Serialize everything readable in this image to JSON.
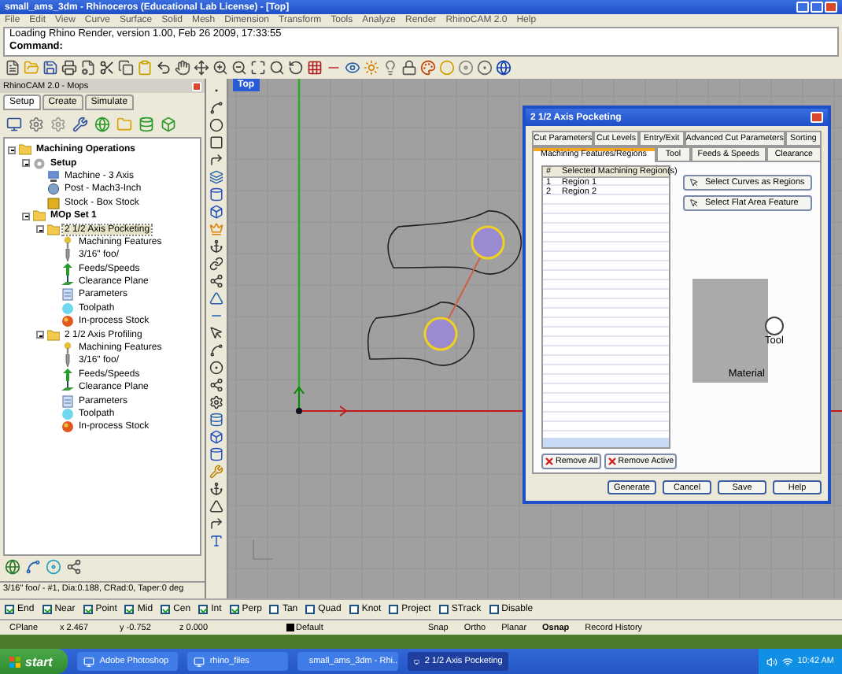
{
  "window": {
    "title": "small_ams_3dm - Rhinoceros (Educational Lab License) - [Top]"
  },
  "menu": [
    "File",
    "Edit",
    "View",
    "Curve",
    "Surface",
    "Solid",
    "Mesh",
    "Dimension",
    "Transform",
    "Tools",
    "Analyze",
    "Render",
    "RhinoCAM 2.0",
    "Help"
  ],
  "command_history": [
    "Loading Rhino Render, version 1.00, Feb 26 2009, 17:33:55"
  ],
  "command_prompt": "Command:",
  "mops_panel": {
    "title": "RhinoCAM 2.0 - Mops",
    "tabs": [
      {
        "label": "Setup",
        "selected": true
      },
      {
        "label": "Create",
        "selected": false
      },
      {
        "label": "Simulate",
        "selected": false
      }
    ],
    "tree": [
      {
        "label": "Machining Operations",
        "kind": "folder",
        "expanded": true,
        "selected": false,
        "children": [
          {
            "label": "Setup",
            "kind": "gear",
            "expanded": true,
            "selected": false,
            "children": [
              {
                "label": "Machine - 3 Axis",
                "kind": "machine",
                "selected": false
              },
              {
                "label": "Post - Mach3-Inch",
                "kind": "post",
                "selected": false
              },
              {
                "label": "Stock - Box Stock",
                "kind": "stock",
                "selected": false
              }
            ]
          },
          {
            "label": "MOp Set 1",
            "kind": "folder",
            "expanded": true,
            "selected": false,
            "children": [
              {
                "label": "2 1/2 Axis Pocketing",
                "kind": "folder",
                "expanded": true,
                "selected": true,
                "children": [
                  {
                    "label": "Machining Features",
                    "kind": "feature",
                    "selected": false
                  },
                  {
                    "label": "3/16\" foo/",
                    "kind": "tool",
                    "selected": false
                  },
                  {
                    "label": "Feeds/Speeds",
                    "kind": "feeds",
                    "selected": false
                  },
                  {
                    "label": "Clearance Plane",
                    "kind": "plane",
                    "selected": false
                  },
                  {
                    "label": "Parameters",
                    "kind": "params",
                    "selected": false
                  },
                  {
                    "label": "Toolpath",
                    "kind": "toolpath",
                    "selected": false
                  },
                  {
                    "label": "In-process Stock",
                    "kind": "inprocess",
                    "selected": false
                  }
                ]
              },
              {
                "label": "2 1/2 Axis Profiling",
                "kind": "folder",
                "expanded": true,
                "selected": false,
                "children": [
                  {
                    "label": "Machining Features",
                    "kind": "feature",
                    "selected": false
                  },
                  {
                    "label": "3/16\" foo/",
                    "kind": "tool",
                    "selected": false
                  },
                  {
                    "label": "Feeds/Speeds",
                    "kind": "feeds",
                    "selected": false
                  },
                  {
                    "label": "Clearance Plane",
                    "kind": "plane",
                    "selected": false
                  },
                  {
                    "label": "Parameters",
                    "kind": "params",
                    "selected": false
                  },
                  {
                    "label": "Toolpath",
                    "kind": "toolpath",
                    "selected": false
                  },
                  {
                    "label": "In-process Stock",
                    "kind": "inprocess",
                    "selected": false
                  }
                ]
              }
            ]
          }
        ]
      }
    ],
    "status": "3/16\" foo/ - #1, Dia:0.188, CRad:0, Taper:0 deg"
  },
  "viewport": {
    "label": "Top"
  },
  "dialog": {
    "title": "2 1/2 Axis Pocketing",
    "tab_rows": [
      [
        {
          "label": "Cut Parameters",
          "selected": false
        },
        {
          "label": "Cut Levels",
          "selected": false
        },
        {
          "label": "Entry/Exit",
          "selected": false
        },
        {
          "label": "Advanced Cut Parameters",
          "selected": false
        },
        {
          "label": "Sorting",
          "selected": false
        }
      ],
      [
        {
          "label": "Machining Features/Regions",
          "selected": true
        },
        {
          "label": "Tool",
          "selected": false
        },
        {
          "label": "Feeds & Speeds",
          "selected": false
        },
        {
          "label": "Clearance",
          "selected": false
        }
      ]
    ],
    "regions": {
      "columns": [
        "#",
        "Selected Machining Region(s)"
      ],
      "rows": [
        [
          "1",
          "Region 1"
        ],
        [
          "2",
          "Region 2"
        ]
      ]
    },
    "select_buttons": [
      "Select Curves as Regions",
      "Select Flat Area Feature"
    ],
    "diagram": {
      "material": "Material",
      "tool": "Tool"
    },
    "remove_buttons": [
      "Remove All",
      "Remove Active"
    ],
    "buttons": [
      "Generate",
      "Cancel",
      "Save",
      "Help"
    ]
  },
  "snaps": [
    {
      "label": "End",
      "checked": true
    },
    {
      "label": "Near",
      "checked": true
    },
    {
      "label": "Point",
      "checked": true
    },
    {
      "label": "Mid",
      "checked": true
    },
    {
      "label": "Cen",
      "checked": true
    },
    {
      "label": "Int",
      "checked": true
    },
    {
      "label": "Perp",
      "checked": true
    },
    {
      "label": "Tan",
      "checked": false
    },
    {
      "label": "Quad",
      "checked": false
    },
    {
      "label": "Knot",
      "checked": false
    },
    {
      "label": "Project",
      "checked": false
    },
    {
      "label": "STrack",
      "checked": false
    },
    {
      "label": "Disable",
      "checked": false
    }
  ],
  "status_bar": {
    "cplane": "CPlane",
    "x": "x 2.467",
    "y": "y -0.752",
    "z": "z 0.000",
    "layer": "Default",
    "toggles": [
      {
        "label": "Snap",
        "on": false
      },
      {
        "label": "Ortho",
        "on": false
      },
      {
        "label": "Planar",
        "on": false
      },
      {
        "label": "Osnap",
        "on": true
      },
      {
        "label": "Record History",
        "on": false
      }
    ]
  },
  "taskbar": {
    "start": "start",
    "items": [
      {
        "label": "Adobe Photoshop",
        "selected": false
      },
      {
        "label": "rhino_files",
        "selected": false
      },
      {
        "label": "small_ams_3dm - Rhi...",
        "selected": false
      },
      {
        "label": "2 1/2 Axis Pocketing",
        "selected": true
      }
    ],
    "clock": "10:42 AM"
  }
}
